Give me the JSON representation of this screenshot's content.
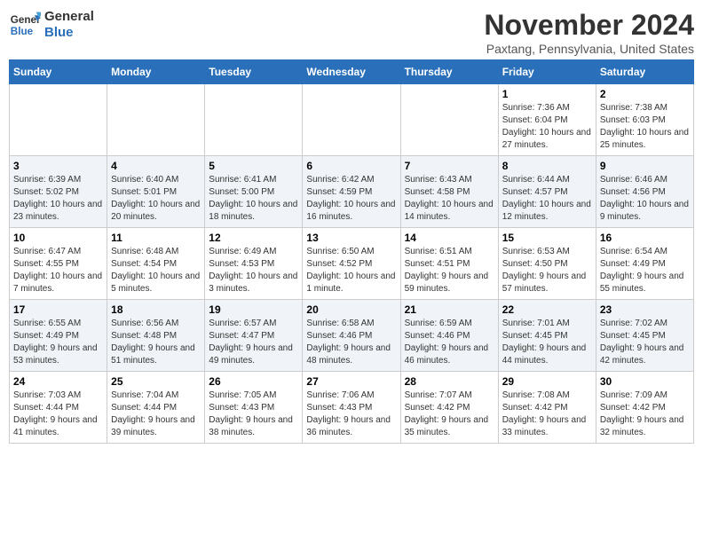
{
  "header": {
    "logo_general": "General",
    "logo_blue": "Blue",
    "month_title": "November 2024",
    "location": "Paxtang, Pennsylvania, United States"
  },
  "days_of_week": [
    "Sunday",
    "Monday",
    "Tuesday",
    "Wednesday",
    "Thursday",
    "Friday",
    "Saturday"
  ],
  "weeks": [
    {
      "days": [
        {
          "num": "",
          "info": ""
        },
        {
          "num": "",
          "info": ""
        },
        {
          "num": "",
          "info": ""
        },
        {
          "num": "",
          "info": ""
        },
        {
          "num": "",
          "info": ""
        },
        {
          "num": "1",
          "info": "Sunrise: 7:36 AM\nSunset: 6:04 PM\nDaylight: 10 hours and 27 minutes."
        },
        {
          "num": "2",
          "info": "Sunrise: 7:38 AM\nSunset: 6:03 PM\nDaylight: 10 hours and 25 minutes."
        }
      ]
    },
    {
      "days": [
        {
          "num": "3",
          "info": "Sunrise: 6:39 AM\nSunset: 5:02 PM\nDaylight: 10 hours and 23 minutes."
        },
        {
          "num": "4",
          "info": "Sunrise: 6:40 AM\nSunset: 5:01 PM\nDaylight: 10 hours and 20 minutes."
        },
        {
          "num": "5",
          "info": "Sunrise: 6:41 AM\nSunset: 5:00 PM\nDaylight: 10 hours and 18 minutes."
        },
        {
          "num": "6",
          "info": "Sunrise: 6:42 AM\nSunset: 4:59 PM\nDaylight: 10 hours and 16 minutes."
        },
        {
          "num": "7",
          "info": "Sunrise: 6:43 AM\nSunset: 4:58 PM\nDaylight: 10 hours and 14 minutes."
        },
        {
          "num": "8",
          "info": "Sunrise: 6:44 AM\nSunset: 4:57 PM\nDaylight: 10 hours and 12 minutes."
        },
        {
          "num": "9",
          "info": "Sunrise: 6:46 AM\nSunset: 4:56 PM\nDaylight: 10 hours and 9 minutes."
        }
      ]
    },
    {
      "days": [
        {
          "num": "10",
          "info": "Sunrise: 6:47 AM\nSunset: 4:55 PM\nDaylight: 10 hours and 7 minutes."
        },
        {
          "num": "11",
          "info": "Sunrise: 6:48 AM\nSunset: 4:54 PM\nDaylight: 10 hours and 5 minutes."
        },
        {
          "num": "12",
          "info": "Sunrise: 6:49 AM\nSunset: 4:53 PM\nDaylight: 10 hours and 3 minutes."
        },
        {
          "num": "13",
          "info": "Sunrise: 6:50 AM\nSunset: 4:52 PM\nDaylight: 10 hours and 1 minute."
        },
        {
          "num": "14",
          "info": "Sunrise: 6:51 AM\nSunset: 4:51 PM\nDaylight: 9 hours and 59 minutes."
        },
        {
          "num": "15",
          "info": "Sunrise: 6:53 AM\nSunset: 4:50 PM\nDaylight: 9 hours and 57 minutes."
        },
        {
          "num": "16",
          "info": "Sunrise: 6:54 AM\nSunset: 4:49 PM\nDaylight: 9 hours and 55 minutes."
        }
      ]
    },
    {
      "days": [
        {
          "num": "17",
          "info": "Sunrise: 6:55 AM\nSunset: 4:49 PM\nDaylight: 9 hours and 53 minutes."
        },
        {
          "num": "18",
          "info": "Sunrise: 6:56 AM\nSunset: 4:48 PM\nDaylight: 9 hours and 51 minutes."
        },
        {
          "num": "19",
          "info": "Sunrise: 6:57 AM\nSunset: 4:47 PM\nDaylight: 9 hours and 49 minutes."
        },
        {
          "num": "20",
          "info": "Sunrise: 6:58 AM\nSunset: 4:46 PM\nDaylight: 9 hours and 48 minutes."
        },
        {
          "num": "21",
          "info": "Sunrise: 6:59 AM\nSunset: 4:46 PM\nDaylight: 9 hours and 46 minutes."
        },
        {
          "num": "22",
          "info": "Sunrise: 7:01 AM\nSunset: 4:45 PM\nDaylight: 9 hours and 44 minutes."
        },
        {
          "num": "23",
          "info": "Sunrise: 7:02 AM\nSunset: 4:45 PM\nDaylight: 9 hours and 42 minutes."
        }
      ]
    },
    {
      "days": [
        {
          "num": "24",
          "info": "Sunrise: 7:03 AM\nSunset: 4:44 PM\nDaylight: 9 hours and 41 minutes."
        },
        {
          "num": "25",
          "info": "Sunrise: 7:04 AM\nSunset: 4:44 PM\nDaylight: 9 hours and 39 minutes."
        },
        {
          "num": "26",
          "info": "Sunrise: 7:05 AM\nSunset: 4:43 PM\nDaylight: 9 hours and 38 minutes."
        },
        {
          "num": "27",
          "info": "Sunrise: 7:06 AM\nSunset: 4:43 PM\nDaylight: 9 hours and 36 minutes."
        },
        {
          "num": "28",
          "info": "Sunrise: 7:07 AM\nSunset: 4:42 PM\nDaylight: 9 hours and 35 minutes."
        },
        {
          "num": "29",
          "info": "Sunrise: 7:08 AM\nSunset: 4:42 PM\nDaylight: 9 hours and 33 minutes."
        },
        {
          "num": "30",
          "info": "Sunrise: 7:09 AM\nSunset: 4:42 PM\nDaylight: 9 hours and 32 minutes."
        }
      ]
    }
  ]
}
